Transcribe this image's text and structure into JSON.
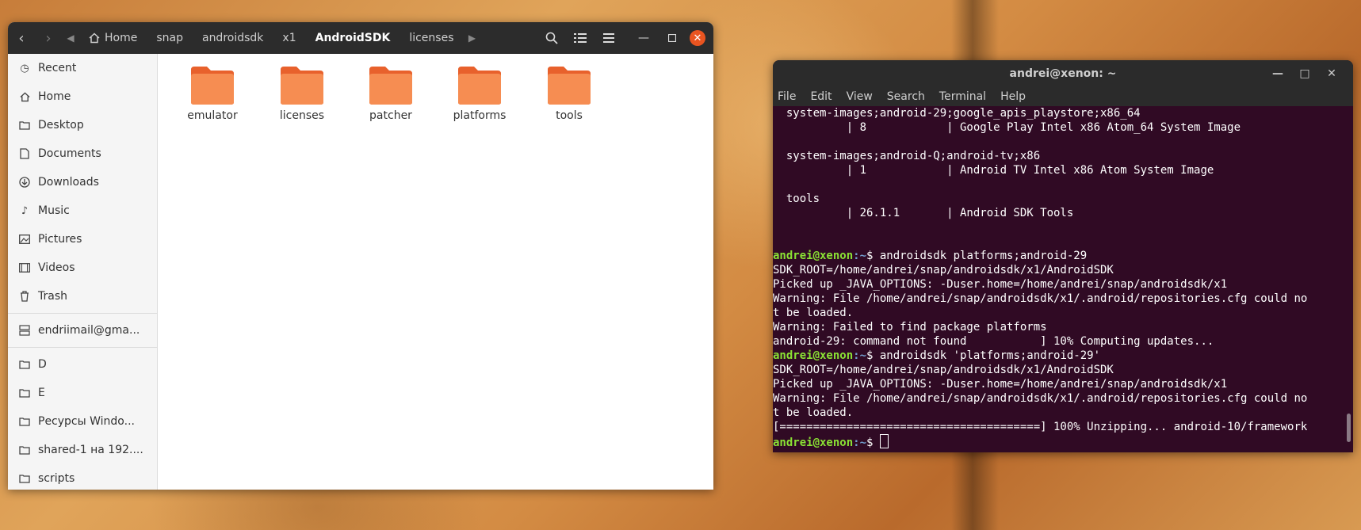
{
  "file_manager": {
    "breadcrumbs": [
      {
        "label": "Home"
      },
      {
        "label": "snap"
      },
      {
        "label": "androidsdk"
      },
      {
        "label": "x1"
      },
      {
        "label": "AndroidSDK"
      },
      {
        "label": "licenses"
      }
    ],
    "sidebar": {
      "places": [
        {
          "label": "Recent",
          "icon": "clock-icon"
        },
        {
          "label": "Home",
          "icon": "home-icon"
        },
        {
          "label": "Desktop",
          "icon": "folder-icon"
        },
        {
          "label": "Documents",
          "icon": "document-icon"
        },
        {
          "label": "Downloads",
          "icon": "download-icon"
        },
        {
          "label": "Music",
          "icon": "music-note-icon"
        },
        {
          "label": "Pictures",
          "icon": "image-icon"
        },
        {
          "label": "Videos",
          "icon": "film-icon"
        },
        {
          "label": "Trash",
          "icon": "trash-icon"
        }
      ],
      "account": {
        "label": "endriimail@gma...",
        "icon": "server-icon"
      },
      "bookmarks": [
        {
          "label": "D",
          "icon": "folder-icon"
        },
        {
          "label": "E",
          "icon": "folder-icon"
        },
        {
          "label": "Ресурсы Windo...",
          "icon": "folder-icon"
        },
        {
          "label": "shared-1 на 192....",
          "icon": "folder-icon"
        },
        {
          "label": "scripts",
          "icon": "folder-icon"
        }
      ]
    },
    "folders": [
      {
        "label": "emulator"
      },
      {
        "label": "licenses"
      },
      {
        "label": "patcher"
      },
      {
        "label": "platforms"
      },
      {
        "label": "tools"
      }
    ],
    "accent_color": "#e95420",
    "folder_color": "#f08a4b"
  },
  "terminal": {
    "title": "andrei@xenon: ~",
    "menu": [
      "File",
      "Edit",
      "View",
      "Search",
      "Terminal",
      "Help"
    ],
    "prompt_user": "andrei@xenon",
    "prompt_path": ":~",
    "prompt_symbol": "$ ",
    "lines": [
      {
        "type": "text",
        "text": "  system-images;android-29;google_apis_playstore;x86_64"
      },
      {
        "type": "text",
        "text": "           | 8            | Google Play Intel x86 Atom_64 System Image"
      },
      {
        "type": "text",
        "text": ""
      },
      {
        "type": "text",
        "text": "  system-images;android-Q;android-tv;x86"
      },
      {
        "type": "text",
        "text": "           | 1            | Android TV Intel x86 Atom System Image"
      },
      {
        "type": "text",
        "text": ""
      },
      {
        "type": "text",
        "text": "  tools"
      },
      {
        "type": "text",
        "text": "           | 26.1.1       | Android SDK Tools"
      },
      {
        "type": "text",
        "text": ""
      },
      {
        "type": "text",
        "text": ""
      },
      {
        "type": "prompt",
        "text": "androidsdk platforms;android-29"
      },
      {
        "type": "text",
        "text": "SDK_ROOT=/home/andrei/snap/androidsdk/x1/AndroidSDK"
      },
      {
        "type": "text",
        "text": "Picked up _JAVA_OPTIONS: -Duser.home=/home/andrei/snap/androidsdk/x1"
      },
      {
        "type": "text",
        "text": "Warning: File /home/andrei/snap/androidsdk/x1/.android/repositories.cfg could no"
      },
      {
        "type": "text",
        "text": "t be loaded."
      },
      {
        "type": "text",
        "text": "Warning: Failed to find package platforms"
      },
      {
        "type": "text",
        "text": "android-29: command not found           ] 10% Computing updates..."
      },
      {
        "type": "prompt",
        "text": "androidsdk 'platforms;android-29'"
      },
      {
        "type": "text",
        "text": "SDK_ROOT=/home/andrei/snap/androidsdk/x1/AndroidSDK"
      },
      {
        "type": "text",
        "text": "Picked up _JAVA_OPTIONS: -Duser.home=/home/andrei/snap/androidsdk/x1"
      },
      {
        "type": "text",
        "text": "Warning: File /home/andrei/snap/androidsdk/x1/.android/repositories.cfg could no"
      },
      {
        "type": "text",
        "text": "t be loaded."
      },
      {
        "type": "text",
        "text": "[=======================================] 100% Unzipping... android-10/framework"
      },
      {
        "type": "cursor",
        "text": ""
      }
    ],
    "colors": {
      "background": "#300a24",
      "user": "#8ae234",
      "path": "#729fcf"
    }
  }
}
